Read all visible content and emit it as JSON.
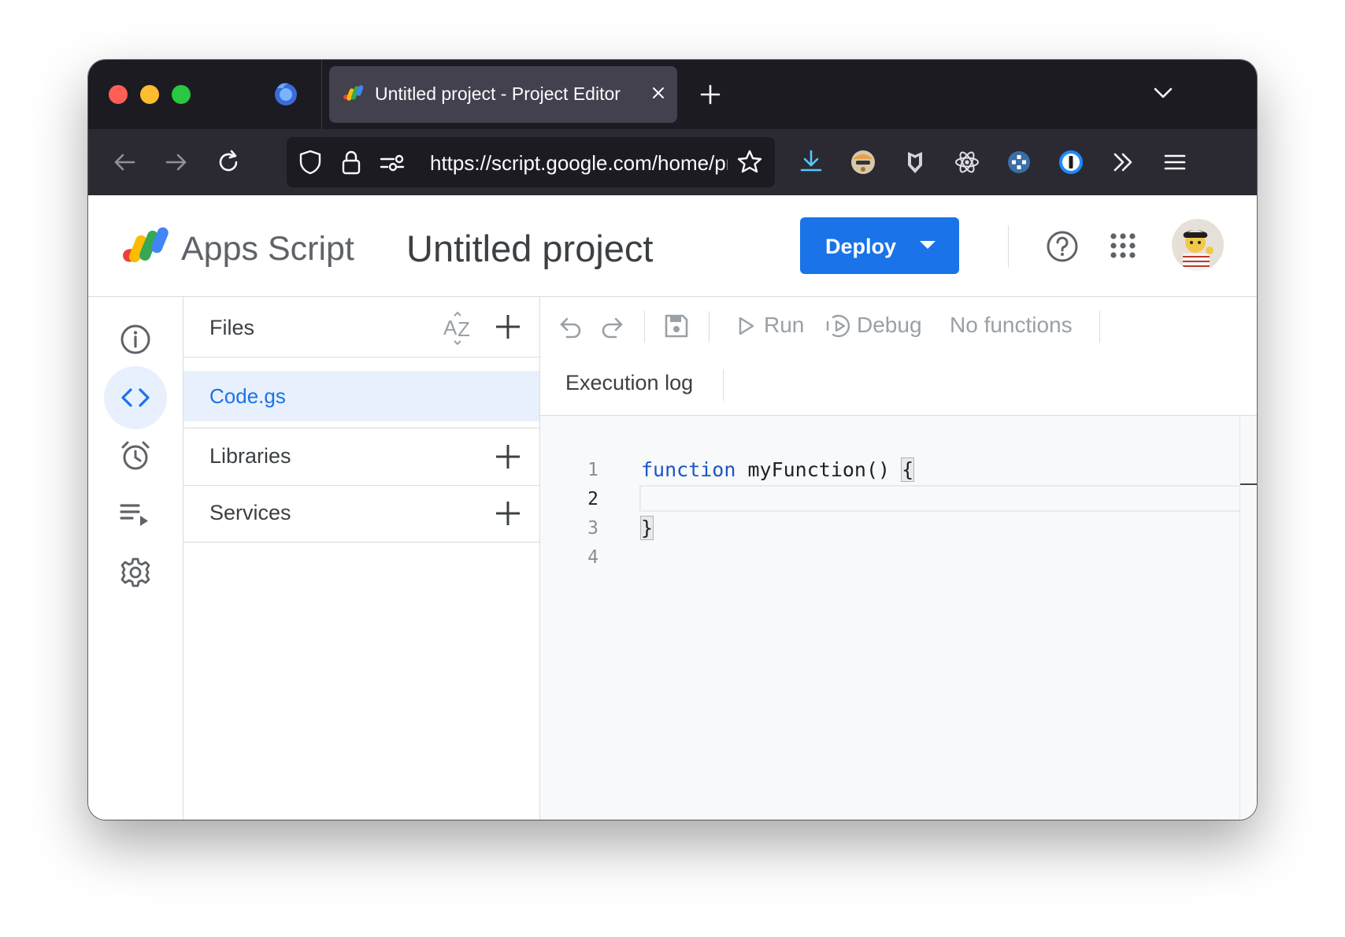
{
  "browser": {
    "tab": {
      "title": "Untitled project - Project Editor"
    },
    "url": "https://script.google.com/home/projects",
    "toolbar_icons": [
      "back-icon",
      "forward-icon",
      "reload-icon",
      "shield-icon",
      "lock-icon",
      "permissions-icon",
      "bookmark-star-icon",
      "download-icon",
      "extension-avatar-icon",
      "extension-shield-icon",
      "react-devtools-icon",
      "extension-plus-icon",
      "1password-icon",
      "overflow-icon",
      "menu-icon"
    ]
  },
  "header": {
    "app_name": "Apps Script",
    "project_title": "Untitled project",
    "deploy_label": "Deploy"
  },
  "files_panel": {
    "files_label": "Files",
    "files": [
      {
        "name": "Code.gs"
      }
    ],
    "libraries_label": "Libraries",
    "services_label": "Services"
  },
  "editor_toolbar": {
    "run_label": "Run",
    "debug_label": "Debug",
    "function_select": "No functions",
    "execution_log_label": "Execution log"
  },
  "code": {
    "line_numbers": [
      "1",
      "2",
      "3",
      "4"
    ],
    "keyword": "function",
    "line1_rest": " myFunction() ",
    "open_brace": "{",
    "close_brace": "}"
  },
  "colors": {
    "accent": "#1a73e8",
    "selected_bg": "#e8f0fe",
    "browser_chrome": "#1c1b22"
  }
}
